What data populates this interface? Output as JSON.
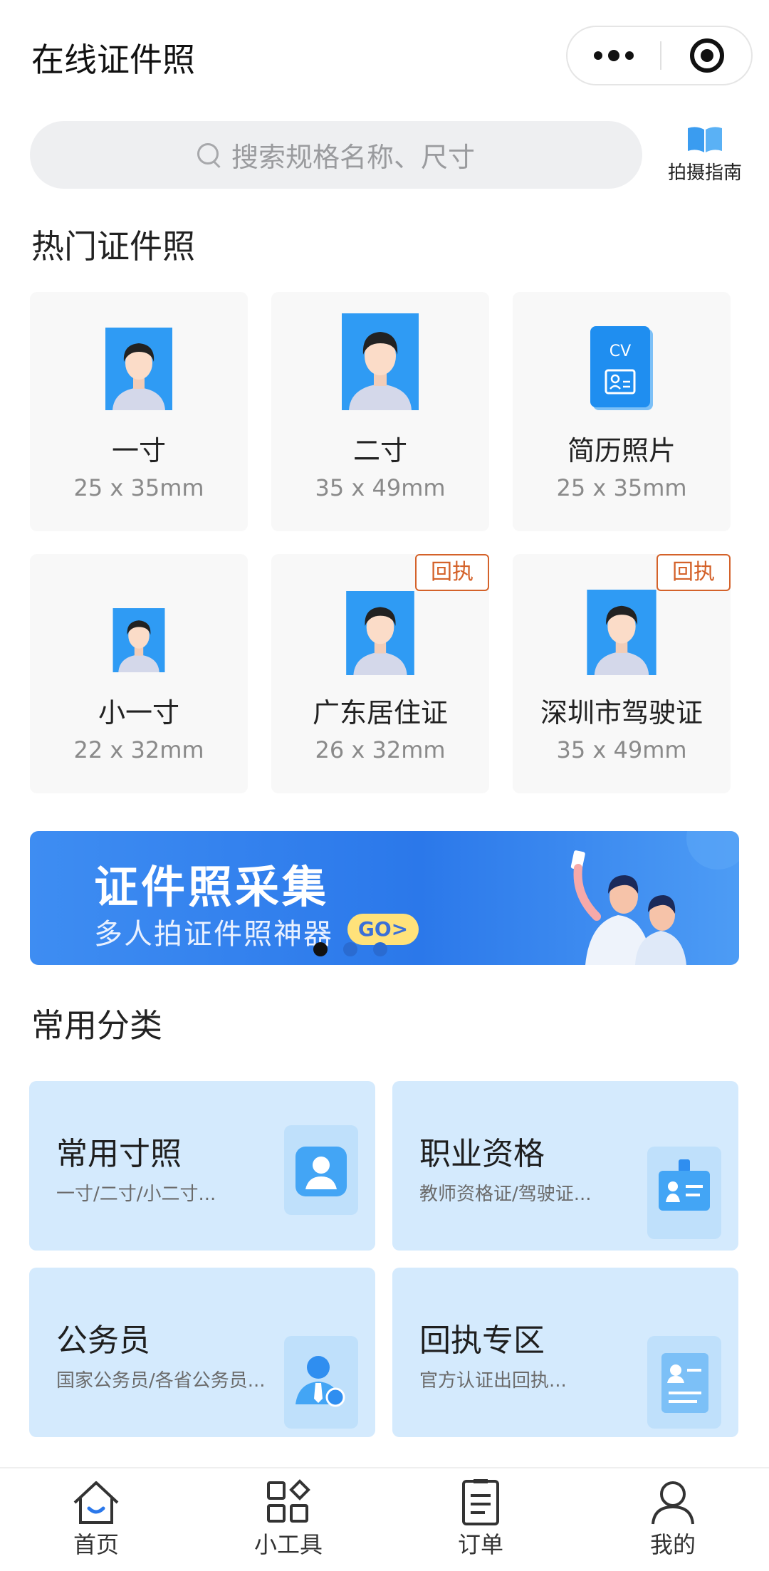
{
  "header": {
    "title": "在线证件照"
  },
  "search": {
    "placeholder": "搜索规格名称、尺寸",
    "guide_label": "拍摄指南"
  },
  "hot_section": {
    "title": "热门证件照",
    "cards": [
      {
        "name": "一寸",
        "size": "25 x 35mm"
      },
      {
        "name": "二寸",
        "size": "35 x 49mm"
      },
      {
        "name": "简历照片",
        "size": "25 x 35mm",
        "icon_text": "CV"
      },
      {
        "name": "小一寸",
        "size": "22 x 32mm"
      },
      {
        "name": "广东居住证",
        "size": "26 x 32mm",
        "tag": "回执"
      },
      {
        "name": "深圳市驾驶证",
        "size": "35 x 49mm",
        "tag": "回执"
      }
    ]
  },
  "banner": {
    "title": "证件照采集",
    "subtitle": "多人拍证件照神器",
    "cta": "GO>",
    "slide_count": 3,
    "active_slide": 1
  },
  "category_section": {
    "title": "常用分类",
    "items": [
      {
        "title": "常用寸照",
        "desc": "一寸/二寸/小二寸..."
      },
      {
        "title": "职业资格",
        "desc": "教师资格证/驾驶证..."
      },
      {
        "title": "公务员",
        "desc": "国家公务员/各省公务员..."
      },
      {
        "title": "回执专区",
        "desc": "官方认证出回执..."
      }
    ]
  },
  "tabbar": {
    "tabs": [
      {
        "label": "首页",
        "icon": "home-icon",
        "active": true
      },
      {
        "label": "小工具",
        "icon": "tools-icon"
      },
      {
        "label": "订单",
        "icon": "order-icon"
      },
      {
        "label": "我的",
        "icon": "profile-icon"
      }
    ]
  },
  "colors": {
    "accent": "#2b78ea",
    "tag": "#d4622a",
    "category_bg": "#d4eafd",
    "card_bg": "#f8f8f8"
  }
}
